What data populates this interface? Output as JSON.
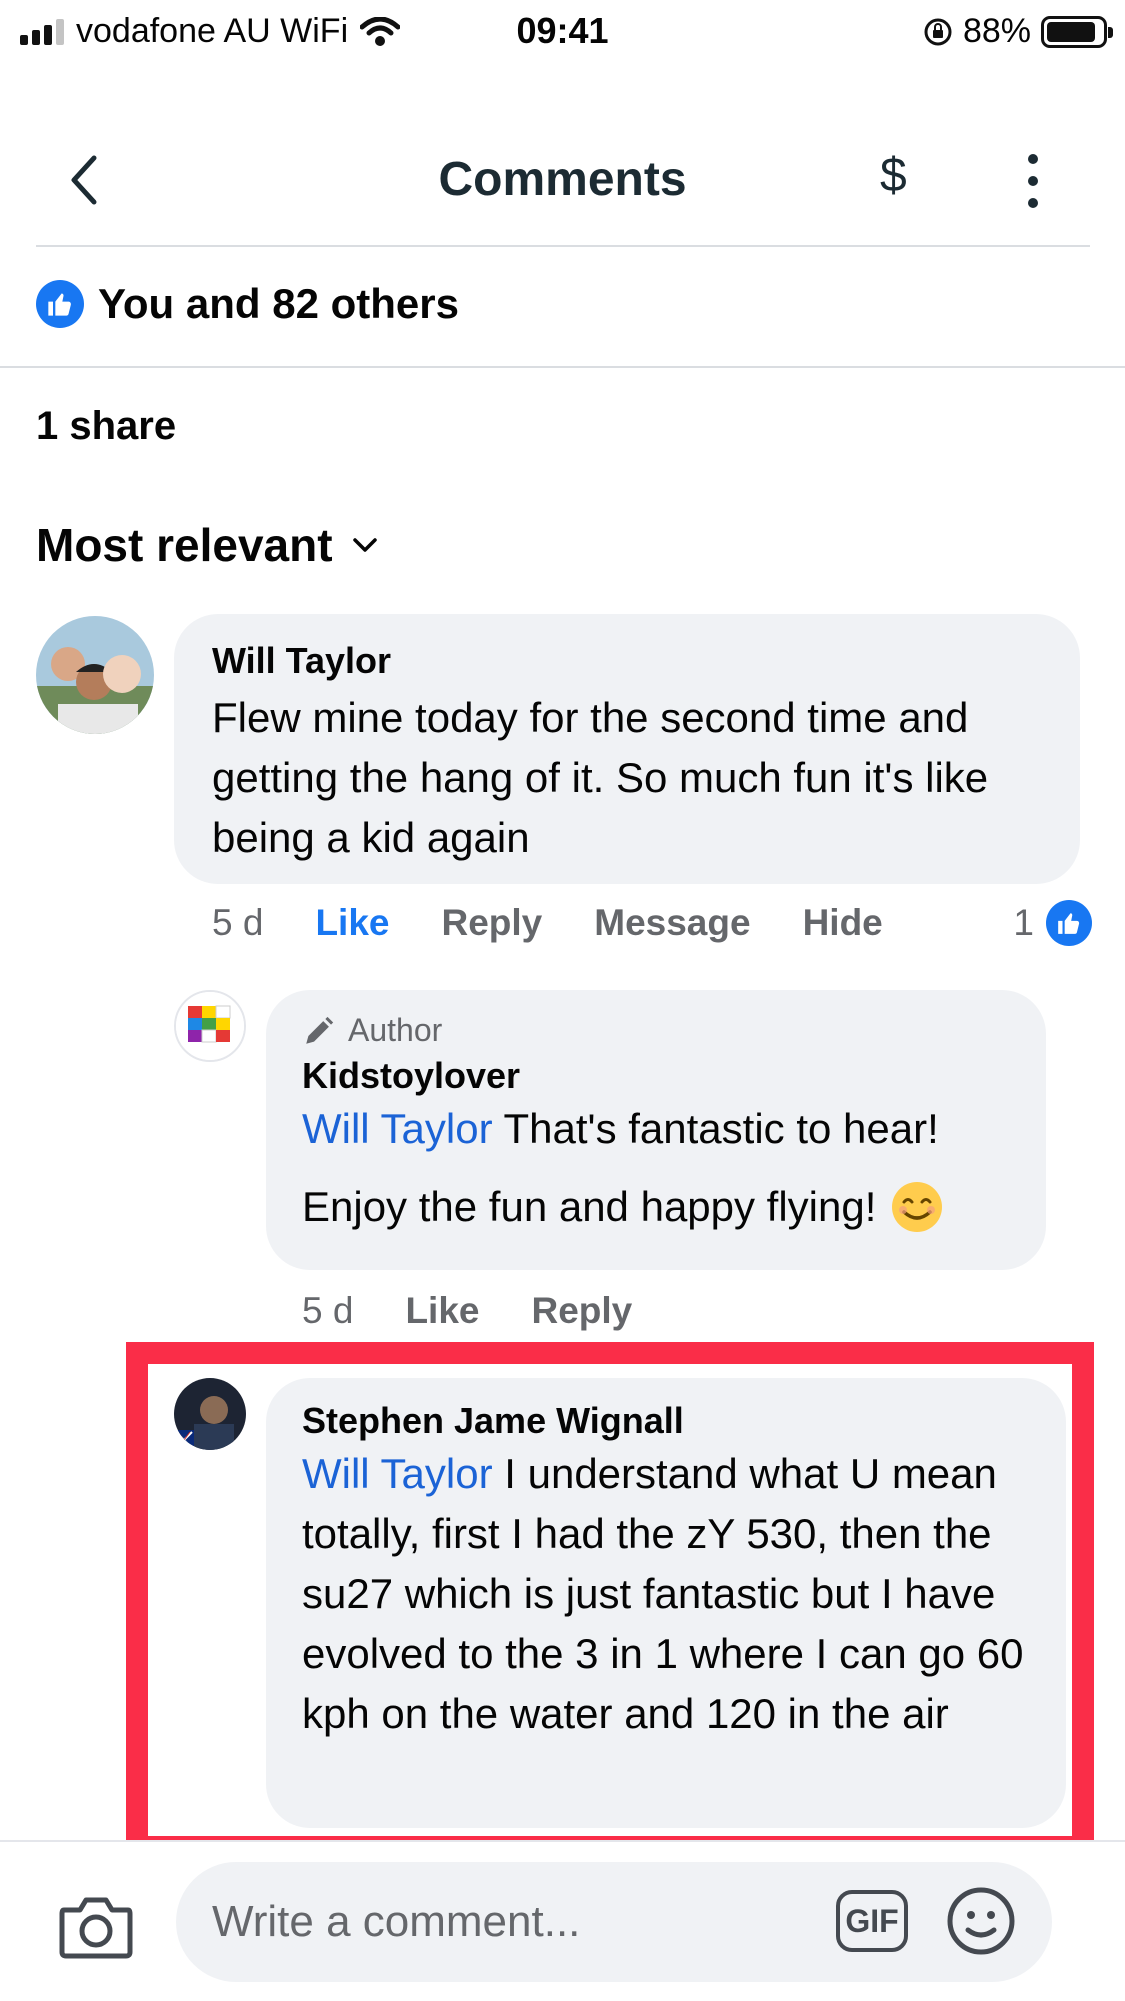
{
  "status_bar": {
    "carrier": "vodafone AU WiFi",
    "time": "09:41",
    "battery": "88%",
    "battery_level": 0.88
  },
  "header": {
    "title": "Comments",
    "dollar_symbol": "$"
  },
  "reactions": {
    "likes_text": "You and 82 others",
    "shares_text": "1 share"
  },
  "sort": {
    "label": "Most relevant"
  },
  "comments": [
    {
      "author": "Will Taylor",
      "text": "Flew mine today for the second time and getting the hang of it. So much fun it's like being a kid again",
      "time": "5 d",
      "actions": [
        "Like",
        "Reply",
        "Message",
        "Hide"
      ],
      "like_count": "1"
    },
    {
      "badge": "Author",
      "author": "Kidstoylover",
      "mention": "Will Taylor",
      "text": "That's fantastic to hear!",
      "text2": "Enjoy the fun and happy flying!",
      "time": "5 d",
      "actions": [
        "Like",
        "Reply"
      ]
    },
    {
      "author": "Stephen Jame Wignall",
      "mention": "Will Taylor",
      "text": "I understand what U mean totally, first I had the zY 530, then the su27 which is just fantastic but I have evolved to the 3 in 1 where I can go 60 kph on the water and 120 in the air"
    }
  ],
  "composer": {
    "placeholder": "Write a comment...",
    "gif_label": "GIF"
  },
  "colors": {
    "accent": "#1877f2",
    "mention": "#1b63d6",
    "bubble": "#f0f2f5",
    "highlight": "#fa2d48"
  }
}
